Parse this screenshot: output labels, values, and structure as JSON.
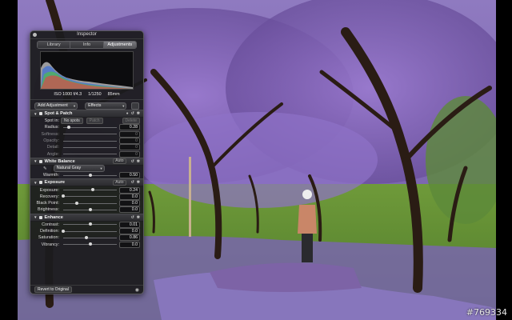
{
  "watermark": "#769334",
  "inspector": {
    "title": "Inspector",
    "tabs": [
      {
        "label": "Library",
        "active": false
      },
      {
        "label": "Info",
        "active": false
      },
      {
        "label": "Adjustments",
        "active": true
      }
    ],
    "exif": {
      "iso_aperture": "ISO 1000  f/4.3",
      "shutter": "1/1250",
      "focal": "85mm"
    },
    "add_adjustment": "Add Adjustment",
    "effects": "Effects",
    "spot_patch": {
      "title": "Spot & Patch",
      "spot_label": "Spot in:",
      "no_spots": "No spots",
      "patch_label": "Patch",
      "delete_label": "Delete",
      "rows": [
        {
          "label": "Radius:",
          "value": "0.28"
        },
        {
          "label": "Softness:",
          "value": "0"
        },
        {
          "label": "Opacity:",
          "value": "0"
        },
        {
          "label": "Detail:",
          "value": "0"
        },
        {
          "label": "Angle:",
          "value": "0"
        }
      ]
    },
    "white_balance": {
      "title": "White Balance",
      "auto": "Auto",
      "preset": "Natural Gray",
      "rows": [
        {
          "label": "Warmth:",
          "value": "0.50",
          "level": 0.5
        }
      ]
    },
    "exposure": {
      "title": "Exposure",
      "auto": "Auto",
      "rows": [
        {
          "label": "Exposure:",
          "value": "0.24",
          "level": 0.55
        },
        {
          "label": "Recovery:",
          "value": "0.0",
          "level": 0.0
        },
        {
          "label": "Black Point:",
          "value": "0.0",
          "level": 0.25
        },
        {
          "label": "Brightness:",
          "value": "0.0",
          "level": 0.5
        }
      ]
    },
    "enhance": {
      "title": "Enhance",
      "rows": [
        {
          "label": "Contrast:",
          "value": "0.01",
          "level": 0.5
        },
        {
          "label": "Definition:",
          "value": "0.0",
          "level": 0.0
        },
        {
          "label": "Saturation:",
          "value": "0.86",
          "level": 0.43
        },
        {
          "label": "Vibrancy:",
          "value": "0.0",
          "level": 0.5
        }
      ]
    },
    "revert": "Revert to Original"
  }
}
